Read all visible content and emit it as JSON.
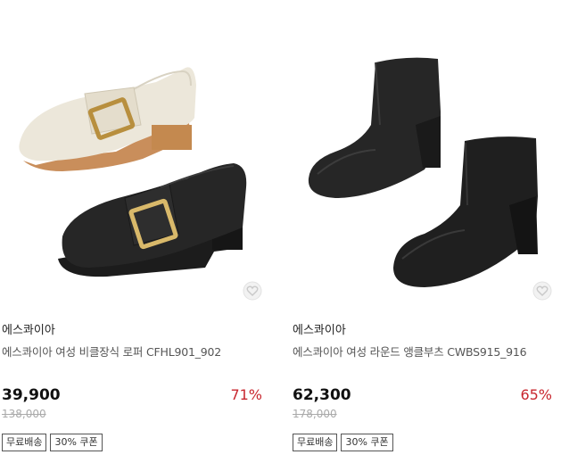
{
  "products": [
    {
      "brand": "에스콰이아",
      "name": "에스콰이아 여성 비클장식 로퍼 CFHL901_902",
      "price": "39,900",
      "original_price": "138,000",
      "discount": "71%",
      "badges": [
        "무료배송",
        "30% 쿠폰"
      ],
      "image": "loafer-pair-ivory-black",
      "wish_icon": "heart-icon"
    },
    {
      "brand": "에스콰이아",
      "name": "에스콰이아 여성 라운드 앵클부츠 CWBS915_916",
      "price": "62,300",
      "original_price": "178,000",
      "discount": "65%",
      "badges": [
        "무료배송",
        "30% 쿠폰"
      ],
      "image": "ankle-boots-black-pair",
      "wish_icon": "heart-icon"
    }
  ],
  "colors": {
    "discount": "#c8262e",
    "strike_price": "#aaaaaa",
    "badge_border": "#555555"
  }
}
